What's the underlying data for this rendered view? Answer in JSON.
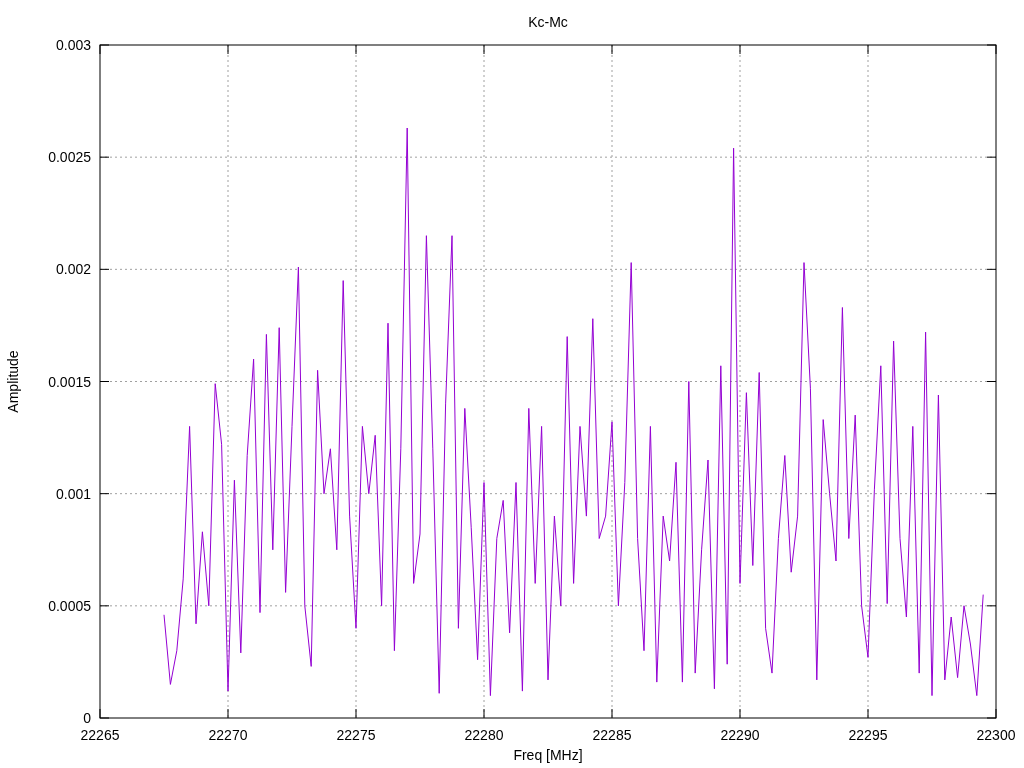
{
  "plot": {
    "chart_data": {
      "type": "line",
      "title": "Kc-Mc",
      "xlabel": "Freq [MHz]",
      "ylabel": "Amplitude",
      "xlim": [
        22265,
        22300
      ],
      "ylim": [
        0,
        0.003
      ],
      "xticks": [
        22265,
        22270,
        22275,
        22280,
        22285,
        22290,
        22295,
        22300
      ],
      "yticks": [
        0,
        0.0005,
        0.001,
        0.0015,
        0.002,
        0.0025,
        0.003
      ],
      "x": [
        22267.5,
        22267.75,
        22268,
        22268.25,
        22268.5,
        22268.75,
        22269,
        22269.25,
        22269.5,
        22269.75,
        22270,
        22270.25,
        22270.5,
        22270.75,
        22271,
        22271.25,
        22271.5,
        22271.75,
        22272,
        22272.25,
        22272.5,
        22272.75,
        22273,
        22273.25,
        22273.5,
        22273.75,
        22274,
        22274.25,
        22274.5,
        22274.75,
        22275,
        22275.25,
        22275.5,
        22275.75,
        22276,
        22276.25,
        22276.5,
        22276.75,
        22277,
        22277.25,
        22277.5,
        22277.75,
        22278,
        22278.25,
        22278.5,
        22278.75,
        22279,
        22279.25,
        22279.5,
        22279.75,
        22280,
        22280.25,
        22280.5,
        22280.75,
        22281,
        22281.25,
        22281.5,
        22281.75,
        22282,
        22282.25,
        22282.5,
        22282.75,
        22283,
        22283.25,
        22283.5,
        22283.75,
        22284,
        22284.25,
        22284.5,
        22284.75,
        22285,
        22285.25,
        22285.5,
        22285.75,
        22286,
        22286.25,
        22286.5,
        22286.75,
        22287,
        22287.25,
        22287.5,
        22287.75,
        22288,
        22288.25,
        22288.5,
        22288.75,
        22289,
        22289.25,
        22289.5,
        22289.75,
        22290,
        22290.25,
        22290.5,
        22290.75,
        22291,
        22291.25,
        22291.5,
        22291.75,
        22292,
        22292.25,
        22292.5,
        22292.75,
        22293,
        22293.25,
        22293.5,
        22293.75,
        22294,
        22294.25,
        22294.5,
        22294.75,
        22295,
        22295.25,
        22295.5,
        22295.75,
        22296,
        22296.25,
        22296.5,
        22296.75,
        22297,
        22297.25,
        22297.5,
        22297.75,
        22298,
        22298.25,
        22298.5,
        22298.75,
        22299,
        22299.25,
        22299.5
      ],
      "grid": true,
      "series": [
        {
          "color": "#9400d3",
          "values": [
            0.00046,
            0.00015,
            0.0003,
            0.00062,
            0.0013,
            0.00042,
            0.00083,
            0.0005,
            0.00149,
            0.00122,
            0.00012,
            0.00106,
            0.00029,
            0.00117,
            0.0016,
            0.00047,
            0.00171,
            0.00075,
            0.00174,
            0.00056,
            0.0013,
            0.00201,
            0.0005,
            0.00023,
            0.00155,
            0.001,
            0.0012,
            0.00075,
            0.00195,
            0.0009,
            0.0004,
            0.0013,
            0.001,
            0.00126,
            0.0005,
            0.00176,
            0.0003,
            0.0012,
            0.00263,
            0.0006,
            0.00082,
            0.00215,
            0.0012,
            0.00011,
            0.0014,
            0.00215,
            0.0004,
            0.00138,
            0.00085,
            0.00026,
            0.00105,
            0.0001,
            0.0008,
            0.00097,
            0.00038,
            0.00105,
            0.00012,
            0.00138,
            0.0006,
            0.0013,
            0.00017,
            0.0009,
            0.0005,
            0.0017,
            0.0006,
            0.0013,
            0.0009,
            0.00178,
            0.0008,
            0.0009,
            0.00132,
            0.0005,
            0.00105,
            0.00203,
            0.0008,
            0.0003,
            0.0013,
            0.00016,
            0.0009,
            0.0007,
            0.00114,
            0.00016,
            0.0015,
            0.0002,
            0.00075,
            0.00115,
            0.00013,
            0.00157,
            0.00024,
            0.00254,
            0.0006,
            0.00145,
            0.00068,
            0.00154,
            0.0004,
            0.0002,
            0.0008,
            0.00117,
            0.00065,
            0.0009,
            0.00203,
            0.00147,
            0.00017,
            0.00133,
            0.001,
            0.0007,
            0.00183,
            0.0008,
            0.00135,
            0.0005,
            0.00027,
            0.00102,
            0.00157,
            0.00051,
            0.00168,
            0.0008,
            0.00045,
            0.0013,
            0.0002,
            0.00172,
            0.0001,
            0.00144,
            0.00017,
            0.00045,
            0.00018,
            0.0005,
            0.00033,
            0.0001,
            0.00055
          ]
        }
      ]
    }
  }
}
